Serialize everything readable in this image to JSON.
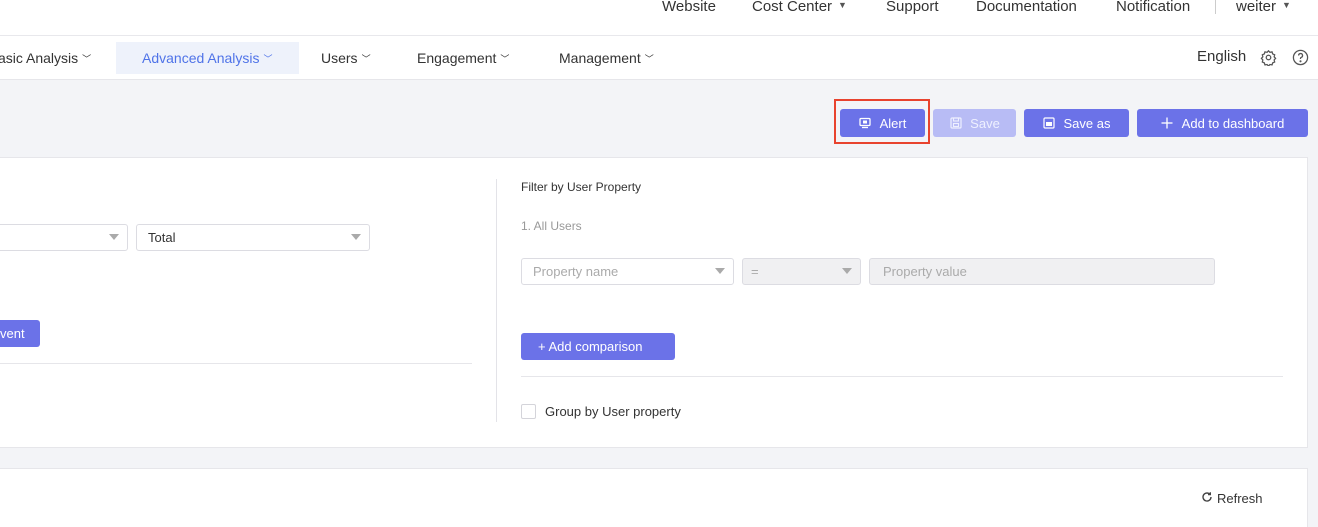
{
  "topnav": {
    "website": "Website",
    "cost_center": "Cost Center",
    "support": "Support",
    "documentation": "Documentation",
    "notification": "Notification",
    "user": "weiter"
  },
  "menu": {
    "basic_analysis": "asic Analysis",
    "advanced_analysis": "Advanced Analysis",
    "users": "Users",
    "engagement": "Engagement",
    "management": "Management",
    "language": "English"
  },
  "toolbar": {
    "alert": "Alert",
    "save": "Save",
    "save_as": "Save as",
    "add_to_dashboard": "Add to dashboard"
  },
  "left": {
    "select1_value": "",
    "select2_value": "Total",
    "add_event_partial": "vent"
  },
  "right": {
    "filter_title": "Filter by User Property",
    "all_users": "1. All Users",
    "property_name_placeholder": "Property name",
    "operator": "=",
    "property_value_placeholder": "Property value",
    "add_comparison": "+ Add comparison",
    "group_by": "Group by User property"
  },
  "bottom": {
    "refresh": "Refresh"
  },
  "colors": {
    "accent": "#6b72e8",
    "active_menu": "#4f73e8",
    "highlight": "#e8432e"
  }
}
